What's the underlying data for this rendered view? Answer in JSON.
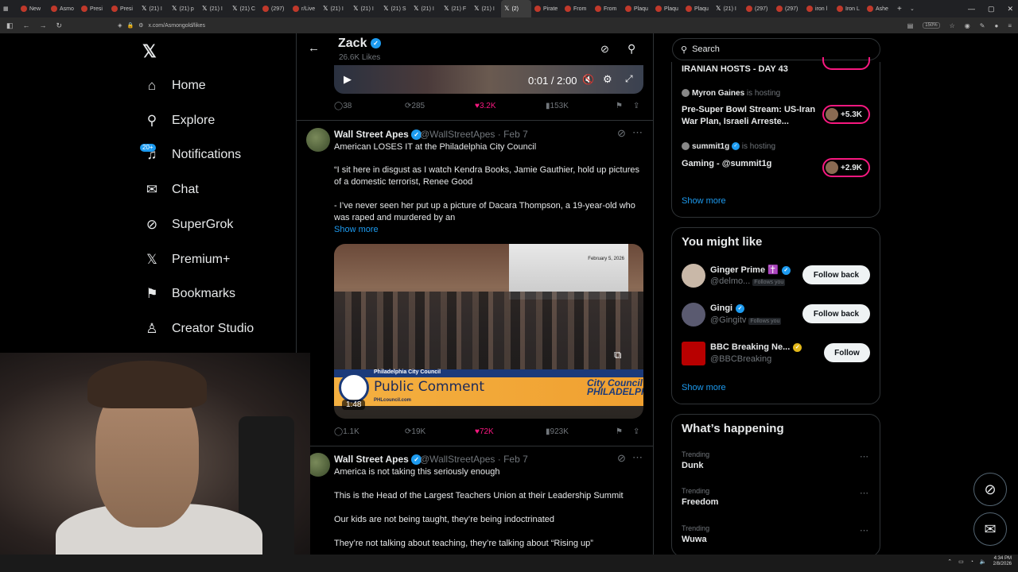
{
  "browser": {
    "tabs": [
      {
        "label": "New",
        "icon": "tab-icon"
      },
      {
        "label": "Asmo",
        "icon": "tab-icon"
      },
      {
        "label": "Presi",
        "icon": "tab-icon"
      },
      {
        "label": "Presi",
        "icon": "tab-icon"
      },
      {
        "label": "(21) I",
        "icon": "x-icon"
      },
      {
        "label": "(21) p",
        "icon": "x-icon"
      },
      {
        "label": "(21) I",
        "icon": "x-icon"
      },
      {
        "label": "(21) C",
        "icon": "x-icon"
      },
      {
        "label": "(297)",
        "icon": "tab-icon"
      },
      {
        "label": "r/Live",
        "icon": "tab-icon"
      },
      {
        "label": "(21) I",
        "icon": "x-icon"
      },
      {
        "label": "(21) I",
        "icon": "x-icon"
      },
      {
        "label": "(21) S",
        "icon": "x-icon"
      },
      {
        "label": "(21) I",
        "icon": "x-icon"
      },
      {
        "label": "(21) F",
        "icon": "x-icon"
      },
      {
        "label": "(21) I",
        "icon": "x-icon"
      },
      {
        "label": "(2)",
        "icon": "x-icon",
        "active": true
      },
      {
        "label": "Pirate",
        "icon": "tab-icon"
      },
      {
        "label": "From",
        "icon": "tab-icon"
      },
      {
        "label": "From",
        "icon": "tab-icon"
      },
      {
        "label": "Plaqu",
        "icon": "tab-icon"
      },
      {
        "label": "Plaqu",
        "icon": "tab-icon"
      },
      {
        "label": "Plaqu",
        "icon": "tab-icon"
      },
      {
        "label": "(21) I",
        "icon": "x-icon"
      },
      {
        "label": "(297)",
        "icon": "tab-icon"
      },
      {
        "label": "(297)",
        "icon": "tab-icon"
      },
      {
        "label": "iron l",
        "icon": "tab-icon"
      },
      {
        "label": "Iron L",
        "icon": "tab-icon"
      },
      {
        "label": "Ashe",
        "icon": "tab-icon"
      }
    ],
    "url": "x.com/Asmongold/likes",
    "zoom": "150%"
  },
  "left_nav": {
    "items": [
      {
        "label": "Home",
        "icon": "home-icon",
        "glyph": "⌂"
      },
      {
        "label": "Explore",
        "icon": "search-icon",
        "glyph": "⚲"
      },
      {
        "label": "Notifications",
        "icon": "bell-icon",
        "glyph": "♫"
      },
      {
        "label": "Chat",
        "icon": "mail-icon",
        "glyph": "✉"
      },
      {
        "label": "SuperGrok",
        "icon": "grok-icon",
        "glyph": "⊘"
      },
      {
        "label": "Premium+",
        "icon": "x-logo-icon",
        "glyph": "𝕏"
      },
      {
        "label": "Bookmarks",
        "icon": "bookmark-icon",
        "glyph": "⚑"
      },
      {
        "label": "Creator Studio",
        "icon": "flask-icon",
        "glyph": "♙"
      }
    ],
    "notif_badge": "20+"
  },
  "header": {
    "name": "Zack",
    "likes": "26.6K Likes"
  },
  "tweet0": {
    "video_time": "0:01 / 2:00",
    "replies": "38",
    "retweets": "285",
    "likes": "3.2K",
    "views": "153K"
  },
  "tweet1": {
    "name": "Wall Street Apes",
    "handle": "@WallStreetApes · Feb 7",
    "line1": "American LOSES IT at the Philadelphia City Council",
    "line2": "“I sit here in disgust as I watch Kendra Books, Jamie Gauthier, hold up pictures of a domestic terrorist, Renee Good",
    "line3": "- I’ve never seen her put up a picture of Dacara Thompson, a 19-year-old who was raped and murdered by an",
    "show_more": "Show more",
    "video": {
      "banner_top": "Philadelphia City Council",
      "banner_title": "Public Comment",
      "city_logo": "City Council PHILADELPHIA",
      "banner_url": "PHLcouncil.com",
      "date_bug": "February 5, 2026",
      "duration": "1:48"
    },
    "replies": "1.1K",
    "retweets": "19K",
    "likes": "72K",
    "views": "923K"
  },
  "tweet2": {
    "name": "Wall Street Apes",
    "handle": "@WallStreetApes · Feb 7",
    "line1": "America is not taking this seriously enough",
    "line2": "This is the Head of the Largest Teachers Union at their Leadership Summit",
    "line3": "Our kids are not being taught, they’re being indoctrinated",
    "line4": "They’re not talking about teaching, they’re talking about “Rising up”"
  },
  "right": {
    "search_placeholder": "Search",
    "spaces": {
      "first_title": "IRANIAN HOSTS - DAY 43",
      "s2_host": "Myron Gaines",
      "s2_hosting": "is hosting",
      "s2_title": "Pre-Super Bowl Stream: US-Iran War Plan, Israeli Arreste...",
      "s2_count": "+5.3K",
      "s3_host": "summit1g",
      "s3_hosting": "is hosting",
      "s3_title": "Gaming - @summit1g",
      "s3_count": "+2.9K",
      "show_more": "Show more"
    },
    "you_might_like": {
      "title": "You might like",
      "items": [
        {
          "name": "Ginger Prime ✝️",
          "handle": "@delmo...",
          "follows_you": "Follows you",
          "button": "Follow back"
        },
        {
          "name": "Gingi",
          "handle": "@Gingitv",
          "follows_you": "Follows you",
          "button": "Follow back"
        },
        {
          "name": "BBC Breaking Ne...",
          "handle": "@BBCBreaking",
          "follows_you": "",
          "button": "Follow"
        }
      ],
      "show_more": "Show more"
    },
    "whats_happening": {
      "title": "What’s happening",
      "items": [
        {
          "label": "Trending",
          "name": "Dunk"
        },
        {
          "label": "Trending",
          "name": "Freedom"
        },
        {
          "label": "Trending",
          "name": "Wuwa"
        }
      ]
    }
  },
  "taskbar": {
    "time": "4:34 PM",
    "date": "2/8/2026"
  },
  "colors": {
    "accent": "#1d9bf0",
    "like": "#f91880",
    "background": "#000000",
    "muted": "#71767b"
  }
}
